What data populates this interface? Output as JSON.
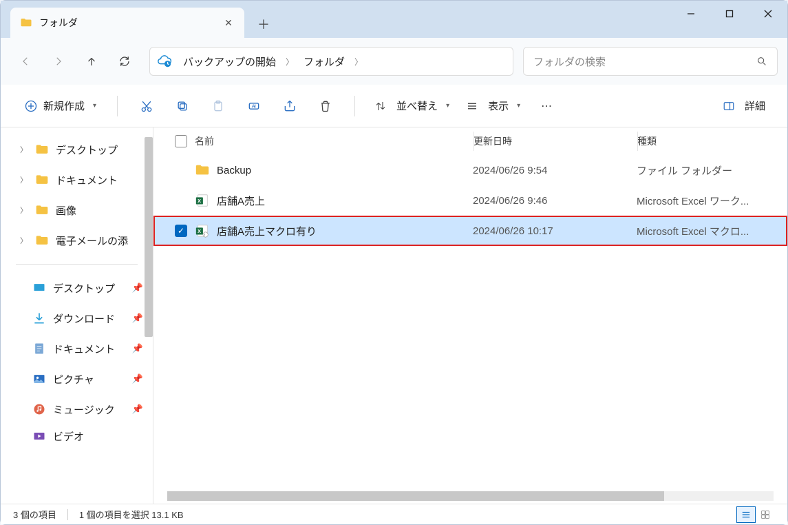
{
  "tab": {
    "title": "フォルダ"
  },
  "breadcrumb": {
    "segments": [
      "バックアップの開始",
      "フォルダ"
    ]
  },
  "search": {
    "placeholder": "フォルダの検索"
  },
  "toolbar": {
    "new_label": "新規作成",
    "sort_label": "並べ替え",
    "view_label": "表示",
    "details_label": "詳細"
  },
  "sidebar": {
    "tree": [
      {
        "label": "デスクトップ"
      },
      {
        "label": "ドキュメント"
      },
      {
        "label": "画像"
      },
      {
        "label": "電子メールの添"
      }
    ],
    "quick": [
      {
        "label": "デスクトップ",
        "icon": "desktop"
      },
      {
        "label": "ダウンロード",
        "icon": "download"
      },
      {
        "label": "ドキュメント",
        "icon": "document"
      },
      {
        "label": "ピクチャ",
        "icon": "pictures"
      },
      {
        "label": "ミュージック",
        "icon": "music"
      },
      {
        "label": "ビデオ",
        "icon": "video"
      }
    ]
  },
  "columns": {
    "name": "名前",
    "date": "更新日時",
    "type": "種類"
  },
  "files": [
    {
      "name": "Backup",
      "date": "2024/06/26 9:54",
      "type": "ファイル フォルダー",
      "icon": "folder",
      "selected": false
    },
    {
      "name": "店舗A売上",
      "date": "2024/06/26 9:46",
      "type": "Microsoft Excel ワーク...",
      "icon": "xlsx",
      "selected": false
    },
    {
      "name": "店舗A売上マクロ有り",
      "date": "2024/06/26 10:17",
      "type": "Microsoft Excel マクロ...",
      "icon": "xlsm",
      "selected": true
    }
  ],
  "status": {
    "count": "3 個の項目",
    "selection": "1 個の項目を選択  13.1 KB"
  }
}
